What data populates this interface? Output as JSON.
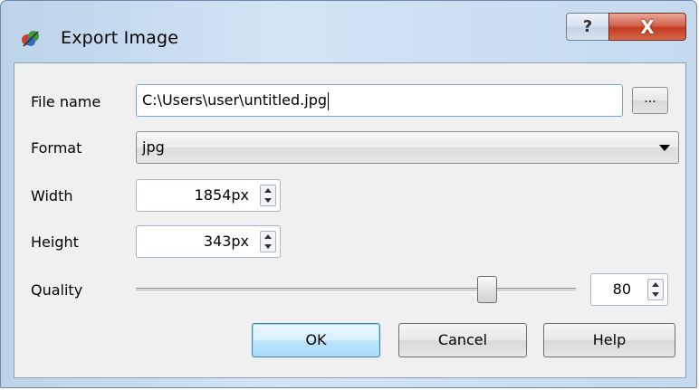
{
  "window": {
    "title": "Export Image",
    "help_label": "?",
    "close_label": "X"
  },
  "form": {
    "file_name": {
      "label": "File name",
      "value": "C:\\Users\\user\\untitled.jpg",
      "browse_label": "..."
    },
    "format": {
      "label": "Format",
      "value": "jpg"
    },
    "width": {
      "label": "Width",
      "value": "1854px"
    },
    "height": {
      "label": "Height",
      "value": "343px"
    },
    "quality": {
      "label": "Quality",
      "value": "80",
      "slider_fraction": 0.8
    }
  },
  "buttons": {
    "ok": "OK",
    "cancel": "Cancel",
    "help": "Help"
  },
  "colors": {
    "accent": "#3c7fb1",
    "close": "#c43c20"
  }
}
